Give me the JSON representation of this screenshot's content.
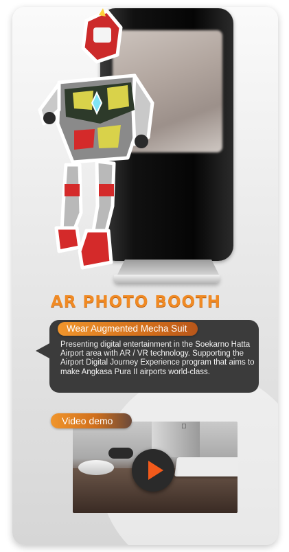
{
  "hero": {
    "figure_icon": "mecha-suit-figure",
    "monitor_icon": "photo-booth-kiosk-icon"
  },
  "title": "AR PHOTO BOOTH",
  "feature": {
    "label": "Wear Augmented Mecha Suit",
    "description": "Presenting digital entertainment in the Soekarno Hatta Airport area with AR / VR technology. Supporting the Airport Digital Journey Experience program that aims to make Angkasa Pura II airports world-class."
  },
  "video": {
    "label": "Video demo",
    "play_icon": "play-icon"
  },
  "colors": {
    "accent": "#f08a24",
    "play_accent": "#f25a1b",
    "box_background": "#3b3b3b"
  }
}
